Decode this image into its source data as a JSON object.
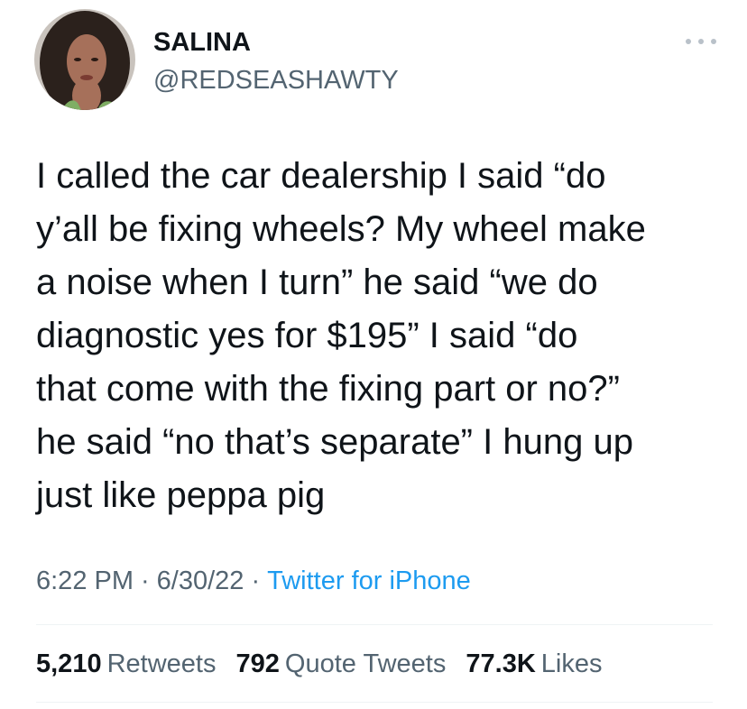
{
  "author": {
    "display_name": "SALINA",
    "handle": "@REDSEASHAWTY"
  },
  "tweet": {
    "text": "I called the car dealership I said “do\ny’all be fixing wheels? My wheel make\na noise when I turn” he said “we do\ndiagnostic yes for $195” I said “do\nthat come with the fixing part or no?”\nhe said “no that’s separate” I hung up\njust like peppa pig",
    "time": "6:22 PM",
    "date": "6/30/22",
    "source": "Twitter for iPhone",
    "separator": "·"
  },
  "stats": {
    "retweets_count": "5,210",
    "retweets_label": "Retweets",
    "quotes_count": "792",
    "quotes_label": "Quote Tweets",
    "likes_count": "77.3K",
    "likes_label": "Likes"
  },
  "icons": {
    "more": "more-horizontal-icon"
  },
  "colors": {
    "text": "#0f1419",
    "secondary": "#536471",
    "link": "#1d9bf0",
    "divider": "#eff3f4"
  }
}
